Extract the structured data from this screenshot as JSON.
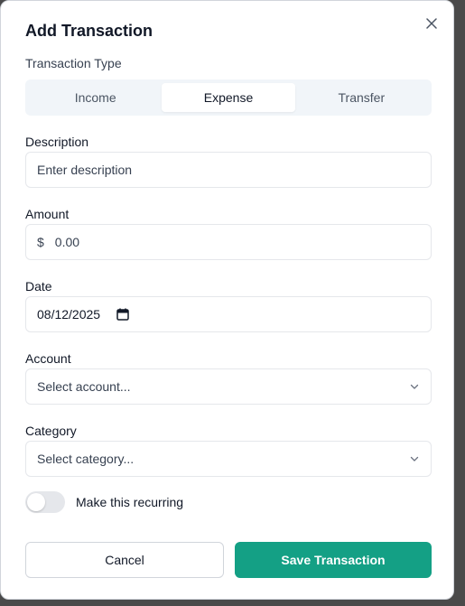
{
  "dialog": {
    "title": "Add Transaction",
    "close_icon": "close-icon"
  },
  "transaction_type": {
    "label": "Transaction Type",
    "options": [
      "Income",
      "Expense",
      "Transfer"
    ],
    "selected": "Expense"
  },
  "description": {
    "label": "Description",
    "placeholder": "Enter description",
    "value": ""
  },
  "amount": {
    "label": "Amount",
    "currency_symbol": "$",
    "placeholder": "0.00",
    "value": ""
  },
  "date": {
    "label": "Date",
    "value": "08/12/2025",
    "icon": "calendar-icon"
  },
  "account": {
    "label": "Account",
    "placeholder": "Select account...",
    "icon": "chevron-down-icon"
  },
  "category": {
    "label": "Category",
    "placeholder": "Select category...",
    "icon": "chevron-down-icon"
  },
  "recurring": {
    "label": "Make this recurring",
    "enabled": false
  },
  "actions": {
    "cancel_label": "Cancel",
    "save_label": "Save Transaction"
  },
  "colors": {
    "accent": "#14a085",
    "segment_bg": "#f1f5f9",
    "toggle_off": "#e5e7eb"
  }
}
